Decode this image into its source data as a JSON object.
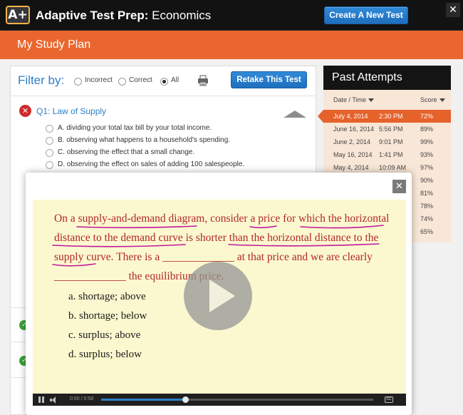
{
  "header": {
    "logo_text": "A+",
    "title_bold": "Adaptive Test Prep:",
    "title_subject": " Economics",
    "new_test_label": "Create A New Test",
    "close_label": "✕"
  },
  "plan_bar": {
    "title": "My Study Plan"
  },
  "filter": {
    "label": "Filter by:",
    "options": [
      {
        "label": "Incorrect",
        "selected": false
      },
      {
        "label": "Correct",
        "selected": false
      },
      {
        "label": "All",
        "selected": true
      }
    ],
    "retake_label": "Retake This Test"
  },
  "question": {
    "title": "Q1: Law of Supply",
    "status": "incorrect",
    "options": [
      "A. dividing your total tax bill by your total income.",
      "B. observing what happens to a household's spending.",
      "C. observing the effect that a small change.",
      "D. observing the effect on sales of adding 100 salespeople."
    ]
  },
  "past_attempts": {
    "title": "Past Attempts",
    "col_date": "Date / Time",
    "col_score": "Score",
    "rows": [
      {
        "date": "July 4, 2014",
        "time": "2:30 PM",
        "score": "72%",
        "selected": true
      },
      {
        "date": "June 16, 2014",
        "time": "5:56 PM",
        "score": "89%"
      },
      {
        "date": "June 2, 2014",
        "time": "9:01 PM",
        "score": "99%"
      },
      {
        "date": "May 16, 2014",
        "time": "1:41 PM",
        "score": "93%"
      },
      {
        "date": "May 4, 2014",
        "time": "10:09 AM",
        "score": "97%"
      },
      {
        "date": "",
        "time": "",
        "score": "90%"
      },
      {
        "date": "",
        "time": "",
        "score": "81%"
      },
      {
        "date": "",
        "time": "",
        "score": "78%"
      },
      {
        "date": "",
        "time": "",
        "score": "74%"
      },
      {
        "date": "",
        "time": "",
        "score": "65%"
      }
    ]
  },
  "video": {
    "close_label": "✕",
    "lines": [
      "On a supply-and-demand diagram, consider a price for which the horizontal",
      "distance to the demand curve is shorter than the horizontal distance to the",
      "supply curve.  There is a _____________ at that price and we are clearly",
      "_____________ the equilibrium price."
    ],
    "choices": [
      "a.  shortage; above",
      "b.  shortage; below",
      "c.  surplus; above",
      "d.  surplus; below"
    ],
    "time_display": "0:00 / 0:58",
    "progress": 0.31,
    "cc_label": "CC"
  },
  "colors": {
    "accent_orange": "#e9672e",
    "link_blue": "#2e7fc9",
    "header_black": "#121212",
    "ink_magenta": "#c0199d"
  }
}
